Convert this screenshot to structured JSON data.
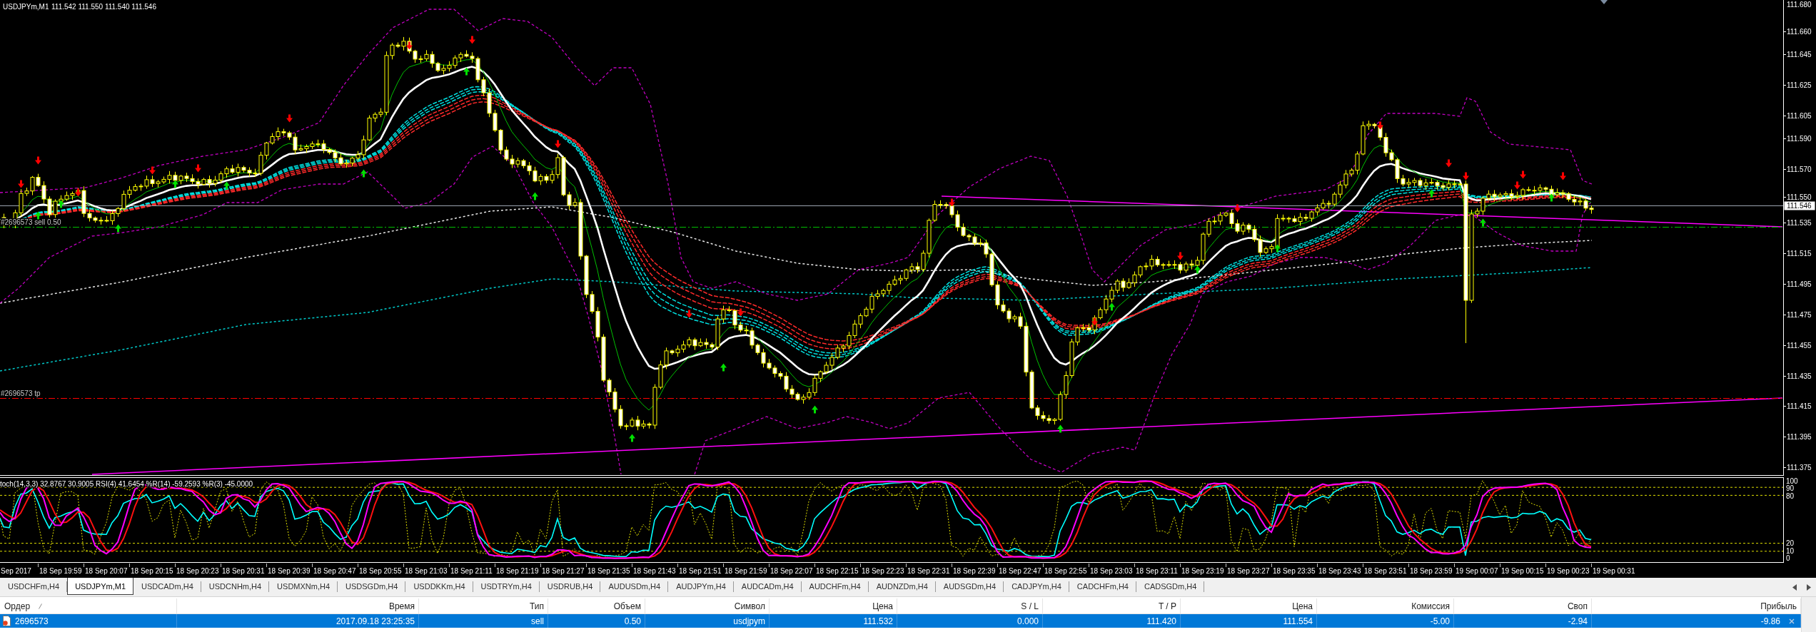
{
  "chart": {
    "title": "USDJPYm,M1",
    "quote": "111.542 111.550 111.540 111.546",
    "price_axis": {
      "labels": [
        "111.680",
        "111.660",
        "111.645",
        "111.625",
        "111.605",
        "111.590",
        "111.570",
        "111.550",
        "111.535",
        "111.515",
        "111.495",
        "111.475",
        "111.455",
        "111.435",
        "111.415",
        "111.395",
        "111.375"
      ],
      "current_price": "111.546"
    },
    "order_lines": [
      {
        "kind": "entry",
        "label": "#2696573 sell 0.50"
      },
      {
        "kind": "take_profit",
        "label": "#2696573 tp"
      }
    ],
    "indicator_window": {
      "legend": "toch(14,3,3) 32.8767 30.9005 RSI(4) 41.6454 %R(14) -59.2593 %R(3) -45.0000",
      "levels": [
        "100",
        "90",
        "80",
        "20",
        "10",
        "0"
      ]
    },
    "time_axis": {
      "labels": [
        "Sep 2017",
        "18 Sep 19:59",
        "18 Sep 20:07",
        "18 Sep 20:15",
        "18 Sep 20:23",
        "18 Sep 20:31",
        "18 Sep 20:39",
        "18 Sep 20:47",
        "18 Sep 20:55",
        "18 Sep 21:03",
        "18 Sep 21:11",
        "18 Sep 21:19",
        "18 Sep 21:27",
        "18 Sep 21:35",
        "18 Sep 21:43",
        "18 Sep 21:51",
        "18 Sep 21:59",
        "18 Sep 22:07",
        "18 Sep 22:15",
        "18 Sep 22:23",
        "18 Sep 22:31",
        "18 Sep 22:39",
        "18 Sep 22:47",
        "18 Sep 22:55",
        "18 Sep 23:03",
        "18 Sep 23:11",
        "18 Sep 23:19",
        "18 Sep 23:27",
        "18 Sep 23:35",
        "18 Sep 23:43",
        "18 Sep 23:51",
        "18 Sep 23:59",
        "19 Sep 00:07",
        "19 Sep 00:15",
        "19 Sep 00:23",
        "19 Sep 00:31"
      ]
    }
  },
  "tabs": [
    {
      "label": "USDCHFm,H4",
      "selected": false
    },
    {
      "label": "USDJPYm,M1",
      "selected": true
    },
    {
      "label": "USDCADm,H4",
      "selected": false
    },
    {
      "label": "USDCNHm,H4",
      "selected": false
    },
    {
      "label": "USDMXNm,H4",
      "selected": false
    },
    {
      "label": "USDSGDm,H4",
      "selected": false
    },
    {
      "label": "USDDKKm,H4",
      "selected": false
    },
    {
      "label": "USDTRYm,H4",
      "selected": false
    },
    {
      "label": "USDRUB,H4",
      "selected": false
    },
    {
      "label": "AUDUSDm,H4",
      "selected": false
    },
    {
      "label": "AUDJPYm,H4",
      "selected": false
    },
    {
      "label": "AUDCADm,H4",
      "selected": false
    },
    {
      "label": "AUDCHFm,H4",
      "selected": false
    },
    {
      "label": "AUDNZDm,H4",
      "selected": false
    },
    {
      "label": "AUDSGDm,H4",
      "selected": false
    },
    {
      "label": "CADJPYm,H4",
      "selected": false
    },
    {
      "label": "CADCHFm,H4",
      "selected": false
    },
    {
      "label": "CADSGDm,H4",
      "selected": false
    }
  ],
  "orders_table": {
    "columns": [
      {
        "label": "Ордер",
        "sorted": true
      },
      {
        "label": "Время",
        "sorted": false
      },
      {
        "label": "Тип",
        "sorted": false
      },
      {
        "label": "Объем",
        "sorted": false
      },
      {
        "label": "Символ",
        "sorted": false
      },
      {
        "label": "Цена",
        "sorted": false
      },
      {
        "label": "S / L",
        "sorted": false
      },
      {
        "label": "T / P",
        "sorted": false
      },
      {
        "label": "Цена",
        "sorted": false
      },
      {
        "label": "Комиссия",
        "sorted": false
      },
      {
        "label": "Своп",
        "sorted": false
      },
      {
        "label": "Прибыль",
        "sorted": false
      }
    ],
    "rows": [
      {
        "selected": true,
        "cells": [
          "2696573",
          "2017.09.18 23:25:35",
          "sell",
          "0.50",
          "usdjpym",
          "111.532",
          "0.000",
          "111.420",
          "111.554",
          "-5.00",
          "-2.94",
          "-9.86"
        ]
      }
    ]
  }
}
